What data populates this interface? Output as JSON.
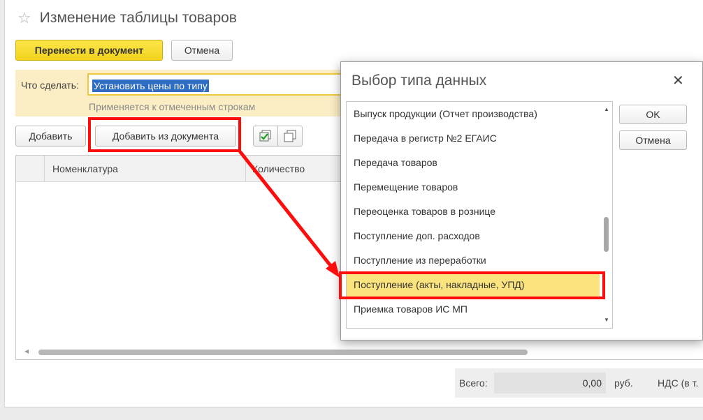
{
  "window": {
    "title": "Изменение таблицы товаров",
    "star_icon": "star-icon"
  },
  "toolbar": {
    "transfer_label": "Перенести в документ",
    "cancel_label": "Отмена"
  },
  "action": {
    "label": "Что сделать:",
    "value": "Установить цены по типу",
    "hint": "Применяется к отмеченным строкам"
  },
  "table_toolbar": {
    "add_label": "Добавить",
    "add_from_doc_label": "Добавить из документа",
    "check_all_icon": "check-all-icon",
    "copy_icon": "copy-icon"
  },
  "table": {
    "columns": [
      "Номенклатура",
      "Количество"
    ]
  },
  "totals": {
    "label": "Всего:",
    "value": "0,00",
    "unit": "руб.",
    "vat": "НДС (в т."
  },
  "dialog": {
    "title": "Выбор типа данных",
    "close_icon": "close-icon",
    "ok_label": "OK",
    "cancel_label": "Отмена",
    "items": [
      "Выпуск продукции (Отчет производства)",
      "Передача в регистр №2 ЕГАИС",
      "Передача товаров",
      "Перемещение товаров",
      "Переоценка товаров в рознице",
      "Поступление доп. расходов",
      "Поступление из переработки",
      "Поступление (акты, накладные, УПД)",
      "Приемка товаров ИС МП"
    ],
    "selected_item": "Поступление (акты, накладные, УПД)"
  },
  "colors": {
    "highlight": "#ff0d0d",
    "primary_button": "#f2d21b",
    "selection": "#fbe37d",
    "panel": "#fbedc4"
  }
}
